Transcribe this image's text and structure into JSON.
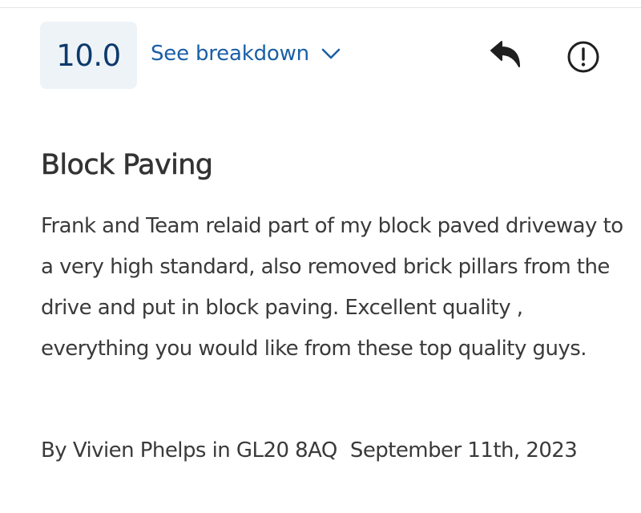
{
  "review": {
    "score": "10.0",
    "breakdown_label": "See breakdown",
    "title": "Block Paving",
    "body": "Frank and Team relaid part of my block paved driveway to a very high standard, also removed brick pillars from the drive and put in block paving. Excellent quality , everything you would like from these top quality guys.",
    "byline": "By Vivien Phelps in GL20 8AQ",
    "date": "September 11th, 2023"
  },
  "icons": {
    "breakdown": "chevron-down-icon",
    "reply": "reply-arrow-icon",
    "report": "exclamation-circle-icon"
  },
  "colors": {
    "score_text": "#0d3a6b",
    "score_bg": "#eef3f8",
    "link": "#1a5fa6",
    "text": "#333333",
    "icon": "#1f1f1f"
  }
}
